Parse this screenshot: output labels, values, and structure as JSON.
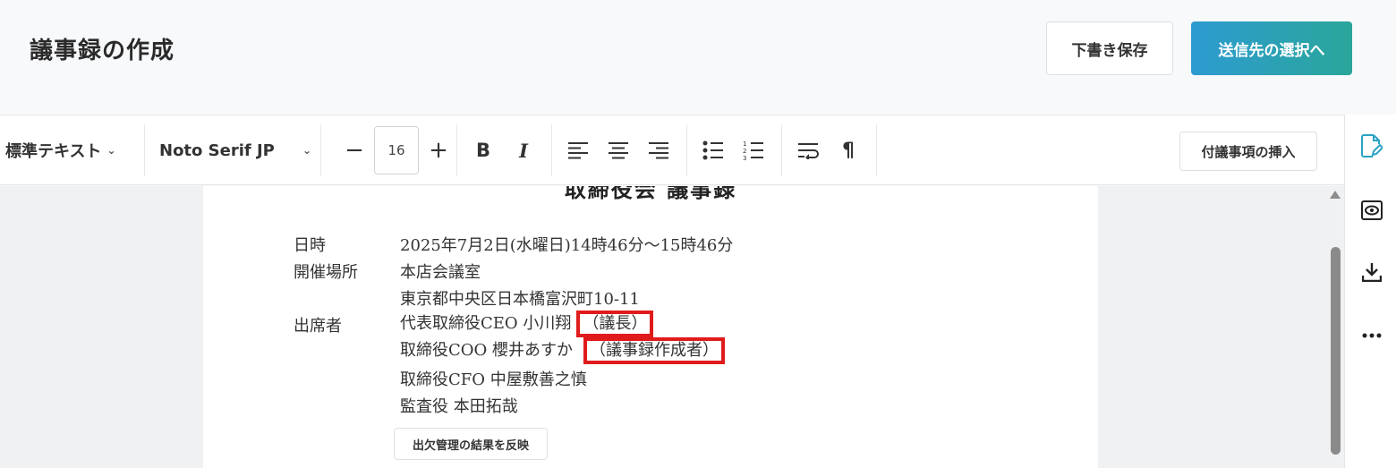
{
  "header": {
    "title": "議事録の作成",
    "draft_label": "下書き保存",
    "next_label": "送信先の選択へ"
  },
  "toolbar": {
    "style_select": "標準テキスト",
    "font_select": "Noto Serif JP",
    "font_size": "16",
    "decrease_glyph": "−",
    "increase_glyph": "+",
    "bold_glyph": "B",
    "italic_glyph": "I",
    "pilcrow_glyph": "¶",
    "attach_label": "付議事項の挿入"
  },
  "document": {
    "title": "取締役会 議事録",
    "rows": [
      {
        "label": "日時",
        "value": "2025年7月2日(水曜日)14時46分～15時46分"
      },
      {
        "label": "開催場所",
        "value": "本店会議室"
      },
      {
        "label": "",
        "value": "東京都中央区日本橋富沢町10-11"
      },
      {
        "label": "出席者",
        "value": "代表取締役CEO 小川翔",
        "tag": "（議長）"
      },
      {
        "label": "",
        "value": "取締役COO 櫻井あすか",
        "tag": "（議事録作成者）"
      },
      {
        "label": "",
        "value": "取締役CFO 中屋敷善之慎"
      },
      {
        "label": "",
        "value": "監査役 本田拓哉"
      }
    ],
    "reflect_label": "出欠管理の結果を反映"
  },
  "rail": {
    "icons": [
      "edit-document-icon",
      "preview-eye-icon",
      "download-icon",
      "more-icon"
    ]
  },
  "colors": {
    "accent_start": "#2d9bd1",
    "accent_end": "#2aa69a",
    "highlight": "#e01b1b",
    "rail_active": "#2aa2c4"
  }
}
